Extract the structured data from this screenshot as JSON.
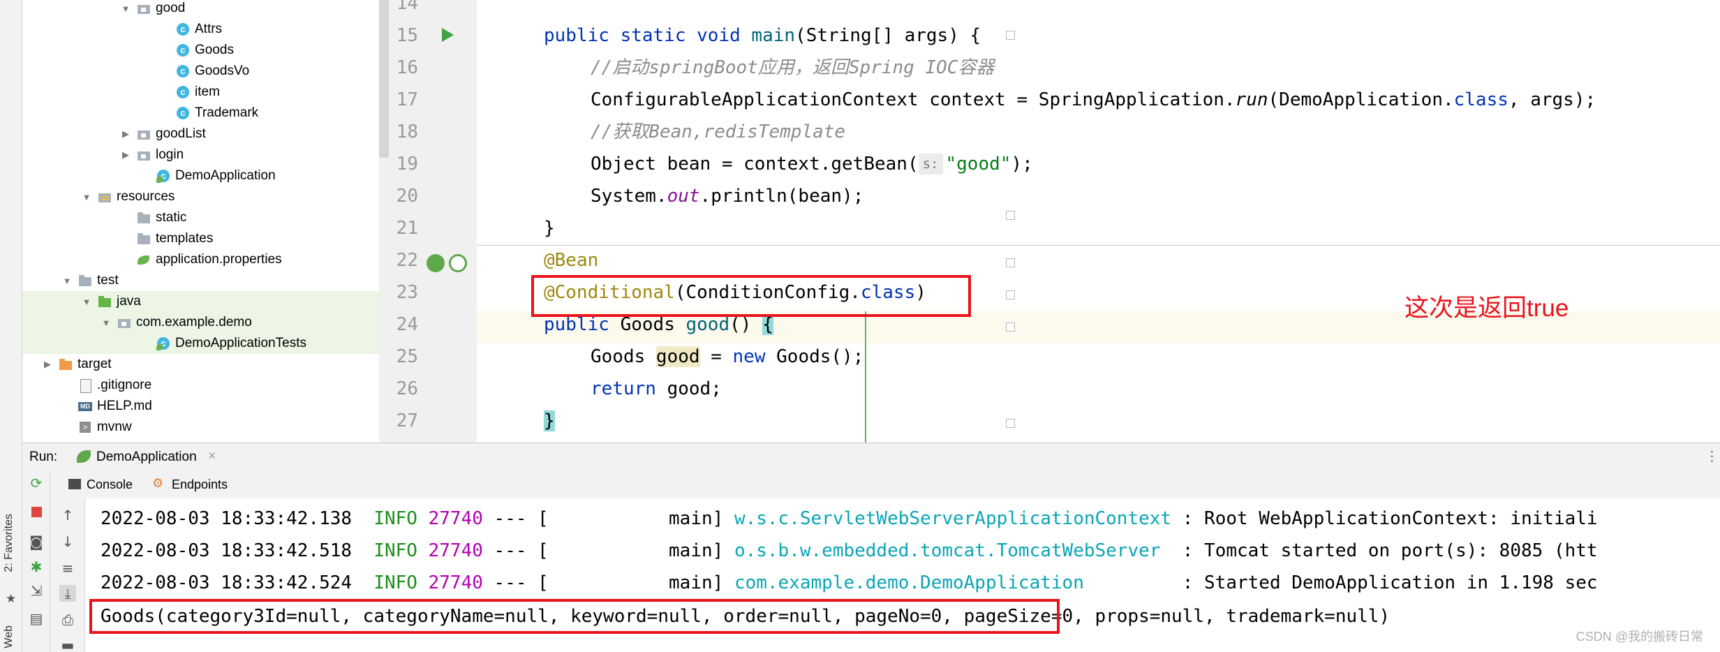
{
  "left_strip": {
    "favorites_tab": "2: Favorites",
    "web_tab": "Web"
  },
  "project_tree": [
    {
      "label": "good",
      "arrow": "▼",
      "icon": "folder-pkg",
      "indent": 164
    },
    {
      "label": "Attrs",
      "arrow": "",
      "icon": "class-c",
      "indent": 220
    },
    {
      "label": "Goods",
      "arrow": "",
      "icon": "class-c",
      "indent": 220
    },
    {
      "label": "GoodsVo",
      "arrow": "",
      "icon": "class-c",
      "indent": 220
    },
    {
      "label": "item",
      "arrow": "",
      "icon": "class-c",
      "indent": 220
    },
    {
      "label": "Trademark",
      "arrow": "",
      "icon": "class-c",
      "indent": 220
    },
    {
      "label": "goodList",
      "arrow": "▶",
      "icon": "folder-pkg",
      "indent": 164
    },
    {
      "label": "login",
      "arrow": "▶",
      "icon": "folder-pkg",
      "indent": 164
    },
    {
      "label": "DemoApplication",
      "arrow": "",
      "icon": "class-app",
      "indent": 192
    },
    {
      "label": "resources",
      "arrow": "▼",
      "icon": "folder-res",
      "indent": 108
    },
    {
      "label": "static",
      "arrow": "",
      "icon": "folder",
      "indent": 164
    },
    {
      "label": "templates",
      "arrow": "",
      "icon": "folder",
      "indent": 164
    },
    {
      "label": "application.properties",
      "arrow": "",
      "icon": "props",
      "indent": 164
    },
    {
      "label": "test",
      "arrow": "▼",
      "icon": "folder",
      "indent": 80
    },
    {
      "label": "java",
      "arrow": "▼",
      "icon": "folder-green",
      "indent": 108
    },
    {
      "label": "com.example.demo",
      "arrow": "▼",
      "icon": "folder-pkg",
      "indent": 136
    },
    {
      "label": "DemoApplicationTests",
      "arrow": "",
      "icon": "class-app",
      "indent": 192
    },
    {
      "label": "target",
      "arrow": "▶",
      "icon": "folder-orange",
      "indent": 52
    },
    {
      "label": ".gitignore",
      "arrow": "",
      "icon": "file-doc",
      "indent": 80
    },
    {
      "label": "HELP.md",
      "arrow": "",
      "icon": "file-md",
      "indent": 80
    },
    {
      "label": "mvnw",
      "arrow": "",
      "icon": "file-sh",
      "indent": 80
    }
  ],
  "editor": {
    "line_numbers": [
      "14",
      "15",
      "16",
      "17",
      "18",
      "19",
      "20",
      "21",
      "22",
      "23",
      "24",
      "25",
      "26",
      "27"
    ],
    "l15": {
      "kw1": "public static void ",
      "fn": "main",
      "rest": "(String[] args) {"
    },
    "l16": {
      "comment": "//启动springBoot应用，返回Spring IOC容器"
    },
    "l17": {
      "a": "ConfigurableApplicationContext context = SpringApplication.",
      "b": "run",
      "c": "(DemoApplication.",
      "d": "class",
      "e": ", args);"
    },
    "l18": {
      "comment": "//获取Bean,redisTemplate"
    },
    "l19": {
      "a": "Object bean = context.getBean(",
      "hint": "s:",
      "str": "\"good\"",
      "b": ");"
    },
    "l20": {
      "a": "System.",
      "b": "out",
      "c": ".println(bean);"
    },
    "l21": {
      "a": "}"
    },
    "l22": {
      "ann": "@Bean"
    },
    "l23": {
      "ann": "@Conditional",
      "a": "(ConditionConfig.",
      "b": "class",
      "c": ")"
    },
    "l24": {
      "kw": "public ",
      "a": "Goods ",
      "fn": "good",
      "b": "() ",
      "brace": "{"
    },
    "l25": {
      "a": "Goods ",
      "var": "good",
      "b": " = ",
      "kw": "new ",
      "c": "Goods();"
    },
    "l26": {
      "kw": "return ",
      "a": "good;"
    },
    "l27": {
      "brace": "}"
    }
  },
  "annotation_note": "这次是返回true",
  "run_panel": {
    "run_label": "Run:",
    "config_tab": "DemoApplication",
    "close_glyph": "×",
    "console_tab": "Console",
    "endpoints_tab": "Endpoints"
  },
  "console_lines": [
    {
      "date": "2022-08-03 18:33:42.138",
      "level": "INFO",
      "pid": "27740",
      "sep": " --- [           main] ",
      "logger": "w.s.c.ServletWebServerApplicationContext",
      "msg": " : Root WebApplicationContext: initiali"
    },
    {
      "date": "2022-08-03 18:33:42.518",
      "level": "INFO",
      "pid": "27740",
      "sep": " --- [           main] ",
      "logger": "o.s.b.w.embedded.tomcat.TomcatWebServer ",
      "msg": " : Tomcat started on port(s): 8085 (htt"
    },
    {
      "date": "2022-08-03 18:33:42.524",
      "level": "INFO",
      "pid": "27740",
      "sep": " --- [           main] ",
      "logger": "com.example.demo.DemoApplication        ",
      "msg": " : Started DemoApplication in 1.198 sec"
    }
  ],
  "console_output": "Goods(category3Id=null, categoryName=null, keyword=null, order=null, pageNo=0, pageSize=0, props=null, trademark=null)",
  "watermark": "CSDN @我的搬砖日常",
  "colors": {
    "highlight_box": "#e8141c",
    "annotation_text": "#e8141c"
  }
}
